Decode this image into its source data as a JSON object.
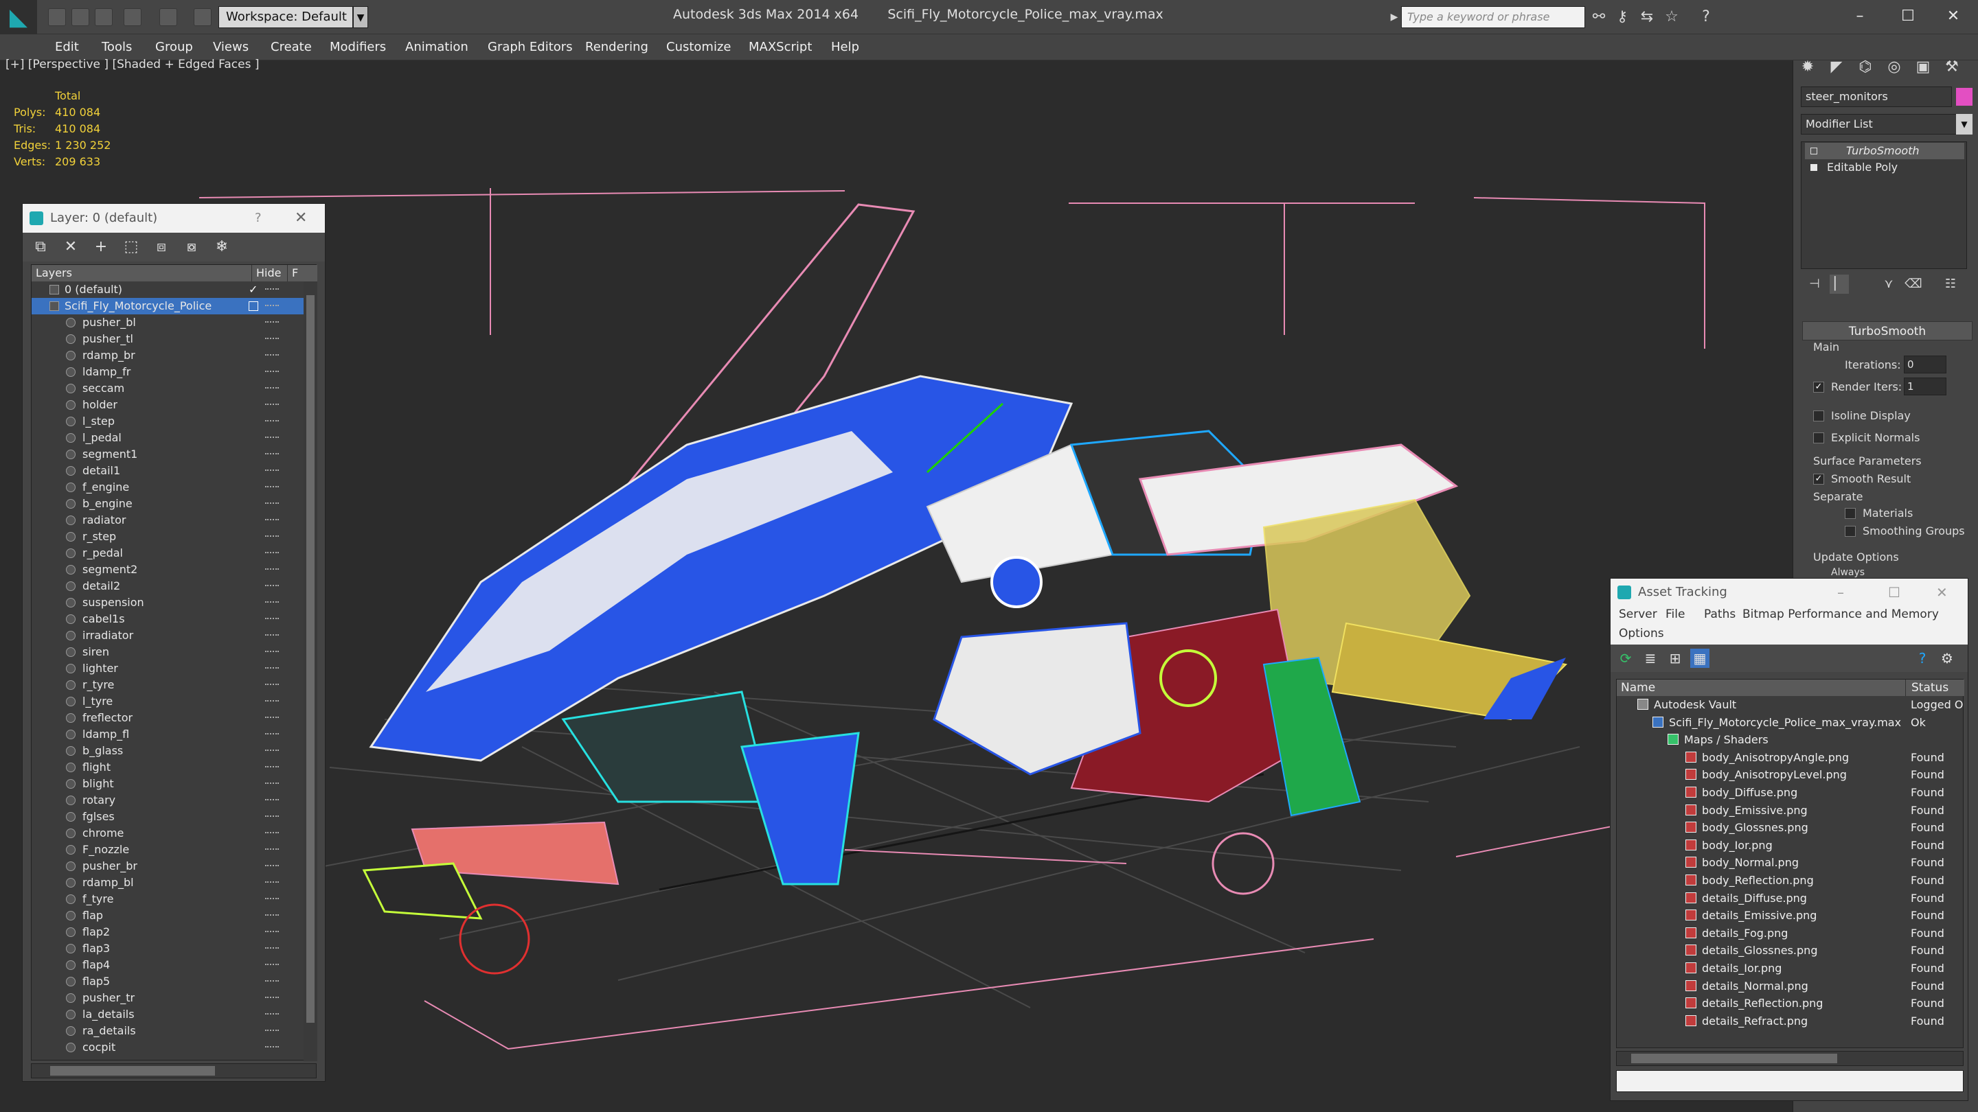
{
  "titlebar": {
    "workspace": "Workspace: Default",
    "app_title": "Autodesk 3ds Max  2014 x64",
    "file_name": "Scifi_Fly_Motorcycle_Police_max_vray.max",
    "search_placeholder": "Type a keyword or phrase"
  },
  "menus": [
    "Edit",
    "Tools",
    "Group",
    "Views",
    "Create",
    "Modifiers",
    "Animation",
    "Graph Editors",
    "Rendering",
    "Customize",
    "MAXScript",
    "Help"
  ],
  "viewport": {
    "label": "[+] [Perspective ] [Shaded + Edged Faces ]",
    "stats_header": "Total",
    "stats": [
      {
        "k": "Polys:",
        "v": "410 084"
      },
      {
        "k": "Tris:",
        "v": "410 084"
      },
      {
        "k": "Edges:",
        "v": "1 230 252"
      },
      {
        "k": "Verts:",
        "v": "209 633"
      }
    ]
  },
  "layer_panel": {
    "title": "Layer: 0 (default)",
    "help": "?",
    "close": "✕",
    "col_layers": "Layers",
    "col_hide": "Hide",
    "col_f": "F",
    "default_layer": "0 (default)",
    "selected_layer": "Scifi_Fly_Motorcycle_Police",
    "children": [
      "pusher_bl",
      "pusher_tl",
      "rdamp_br",
      "ldamp_fr",
      "seccam",
      "holder",
      "l_step",
      "l_pedal",
      "segment1",
      "detail1",
      "f_engine",
      "b_engine",
      "radiator",
      "r_step",
      "r_pedal",
      "segment2",
      "detail2",
      "suspension",
      "cabel1s",
      "irradiator",
      "siren",
      "lighter",
      "r_tyre",
      "l_tyre",
      "freflector",
      "ldamp_fl",
      "b_glass",
      "flight",
      "blight",
      "rotary",
      "fglses",
      "chrome",
      "F_nozzle",
      "pusher_br",
      "rdamp_bl",
      "f_tyre",
      "flap",
      "flap2",
      "flap3",
      "flap4",
      "flap5",
      "pusher_tr",
      "la_details",
      "ra_details",
      "cocpit"
    ]
  },
  "command_panel": {
    "object_name": "steer_monitors",
    "object_color": "#e34fc2",
    "modifier_list": "Modifier List",
    "stack": [
      "TurboSmooth",
      "Editable Poly"
    ],
    "rollout_title": "TurboSmooth",
    "main_label": "Main",
    "iterations_label": "Iterations:",
    "iterations_value": "0",
    "render_iters_label": "Render Iters:",
    "render_iters_value": "1",
    "isoline_label": "Isoline Display",
    "explicit_label": "Explicit Normals",
    "surface_label": "Surface Parameters",
    "smooth_label": "Smooth Result",
    "separate_label": "Separate",
    "materials_label": "Materials",
    "smoothing_groups_label": "Smoothing Groups",
    "update_label": "Update Options",
    "always_label": "Always"
  },
  "asset_tracking": {
    "title": "Asset Tracking",
    "menu": [
      "Server",
      "File",
      "Paths",
      "Bitmap Performance and Memory",
      "Options"
    ],
    "col_name": "Name",
    "col_status": "Status",
    "vault": {
      "name": "Autodesk Vault",
      "status": "Logged O"
    },
    "file": {
      "name": "Scifi_Fly_Motorcycle_Police_max_vray.max",
      "status": "Ok"
    },
    "folder": "Maps / Shaders",
    "maps": [
      {
        "name": "body_AnisotropyAngle.png",
        "status": "Found"
      },
      {
        "name": "body_AnisotropyLevel.png",
        "status": "Found"
      },
      {
        "name": "body_Diffuse.png",
        "status": "Found"
      },
      {
        "name": "body_Emissive.png",
        "status": "Found"
      },
      {
        "name": "body_Glossnes.png",
        "status": "Found"
      },
      {
        "name": "body_Ior.png",
        "status": "Found"
      },
      {
        "name": "body_Normal.png",
        "status": "Found"
      },
      {
        "name": "body_Reflection.png",
        "status": "Found"
      },
      {
        "name": "details_Diffuse.png",
        "status": "Found"
      },
      {
        "name": "details_Emissive.png",
        "status": "Found"
      },
      {
        "name": "details_Fog.png",
        "status": "Found"
      },
      {
        "name": "details_Glossnes.png",
        "status": "Found"
      },
      {
        "name": "details_Ior.png",
        "status": "Found"
      },
      {
        "name": "details_Normal.png",
        "status": "Found"
      },
      {
        "name": "details_Reflection.png",
        "status": "Found"
      },
      {
        "name": "details_Refract.png",
        "status": "Found"
      }
    ]
  }
}
